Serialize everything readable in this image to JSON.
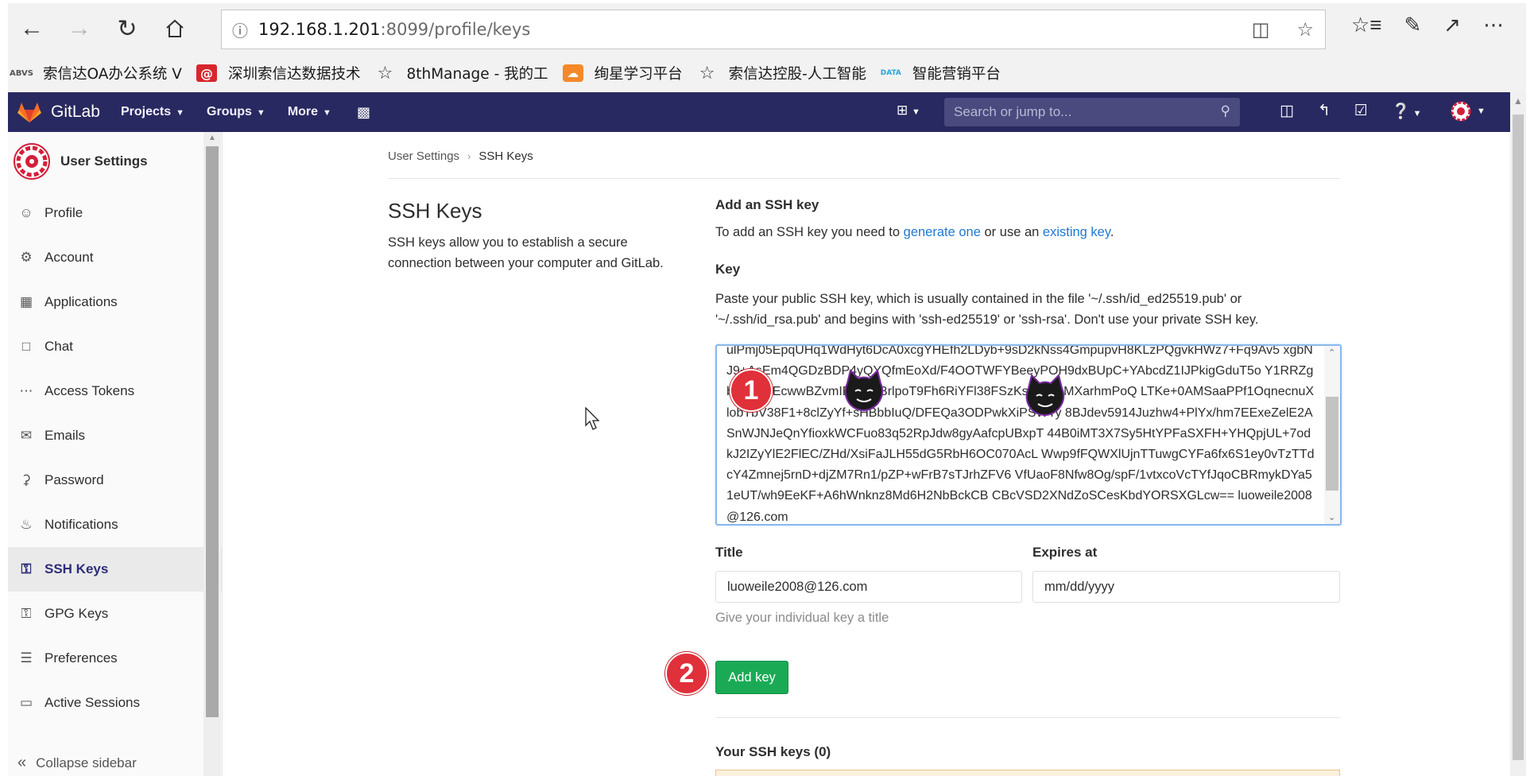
{
  "browser": {
    "url_host": "192.168.1.201",
    "url_path": ":8099/profile/keys",
    "bookmarks": [
      {
        "label": "索信达OA办公系统 V",
        "icon": "abvs-logo"
      },
      {
        "label": "深圳索信达数据技术",
        "icon": "at-sign-icon"
      },
      {
        "label": "8thManage - 我的工",
        "icon": "star-icon"
      },
      {
        "label": "绚星学习平台",
        "icon": "cloud-icon"
      },
      {
        "label": "索信达控股-人工智能",
        "icon": "star-icon"
      },
      {
        "label": "智能营销平台",
        "icon": "data-icon"
      }
    ]
  },
  "gitlab_nav": {
    "brand": "GitLab",
    "menus": [
      "Projects",
      "Groups",
      "More"
    ],
    "search_placeholder": "Search or jump to..."
  },
  "sidebar": {
    "title": "User Settings",
    "items": [
      {
        "label": "Profile",
        "icon": "profile-icon"
      },
      {
        "label": "Account",
        "icon": "account-icon"
      },
      {
        "label": "Applications",
        "icon": "applications-icon"
      },
      {
        "label": "Chat",
        "icon": "chat-icon"
      },
      {
        "label": "Access Tokens",
        "icon": "token-icon"
      },
      {
        "label": "Emails",
        "icon": "mail-icon"
      },
      {
        "label": "Password",
        "icon": "lock-icon"
      },
      {
        "label": "Notifications",
        "icon": "bell-icon"
      },
      {
        "label": "SSH Keys",
        "icon": "key-icon",
        "active": true
      },
      {
        "label": "GPG Keys",
        "icon": "key-icon"
      },
      {
        "label": "Preferences",
        "icon": "preferences-icon"
      },
      {
        "label": "Active Sessions",
        "icon": "monitor-icon"
      }
    ],
    "collapse": "Collapse sidebar"
  },
  "breadcrumb": {
    "parent": "User Settings",
    "current": "SSH Keys"
  },
  "main": {
    "section_title": "SSH Keys",
    "section_desc": "SSH keys allow you to establish a secure connection between your computer and GitLab.",
    "add_title": "Add an SSH key",
    "add_desc_prefix": "To add an SSH key you need to ",
    "add_desc_link1": "generate one",
    "add_desc_middle": " or use an ",
    "add_desc_link2": "existing key",
    "add_desc_suffix": ".",
    "key_label": "Key",
    "key_help": "Paste your public SSH key, which is usually contained in the file '~/.ssh/id_ed25519.pub' or '~/.ssh/id_rsa.pub' and begins with 'ssh-ed25519' or 'ssh-rsa'. Don't use your private SSH key.",
    "key_value": "ulPmj05EpqUHq1WdHyt6DcA0xcgYHEfh2LDyb+9sD2kNss4GmpupvH8KLzPQgvkHWz7+Fq9Av5 xgbNJ9+AsEm4QGDzBDP4yQYQfmEoXd/F4OOTWFYBeeyPOH9dxBUpC+YAbcdZ1IJPkigGduT5o Y1RRZgbwmFiAEcwwBZvmIDs613BrlpoT9Fh6RiYFl38FSzKsLCiR3MXarhmPoQ LTKe+0AMSaaPPf1OqnecnuXlobTbV38F1+8clZyYf+sHBbbIuQ/DFEQa3ODPwkXiPSWTy 8BJdev5914Juzhw4+PlYx/hm7EExeZelE2ASnWJNJeQnYfioxkWCFuo83q52RpJdw8gyAafcpUBxpT 44B0iMT3X7Sy5HtYPFaSXFH+YHQpjUL+7odkJ2IZyYlE2FlEC/ZHd/XsiFaJLH55dG5RbH6OC070AcL Wwp9fFQWXlUjnTTuwgCYFa6fx6S1ey0vTzTTdcY4Zmnej5rnD+djZM7Rn1/pZP+wFrB7sTJrhZFV6 VfUaoF8Nfw8Og/spF/1vtxcoVcTYfJqoCBRmykDYa51eUT/wh9EeKF+A6hWnknz8Md6H2NbBckCB CBcVSD2XNdZoSCesKbdYORSXGLcw== luoweile2008@126.com",
    "title_label": "Title",
    "title_value": "luoweile2008@126.com",
    "expires_label": "Expires at",
    "expires_value": "mm/dd/yyyy",
    "title_hint": "Give your individual key a title",
    "add_button": "Add key",
    "your_keys": "Your SSH keys (0)"
  },
  "annotations": {
    "step1": "1",
    "step2": "2"
  },
  "colors": {
    "navbar": "#292961",
    "add_button": "#1aaa55",
    "link": "#1f78d1",
    "step_badge": "#e0303a"
  }
}
